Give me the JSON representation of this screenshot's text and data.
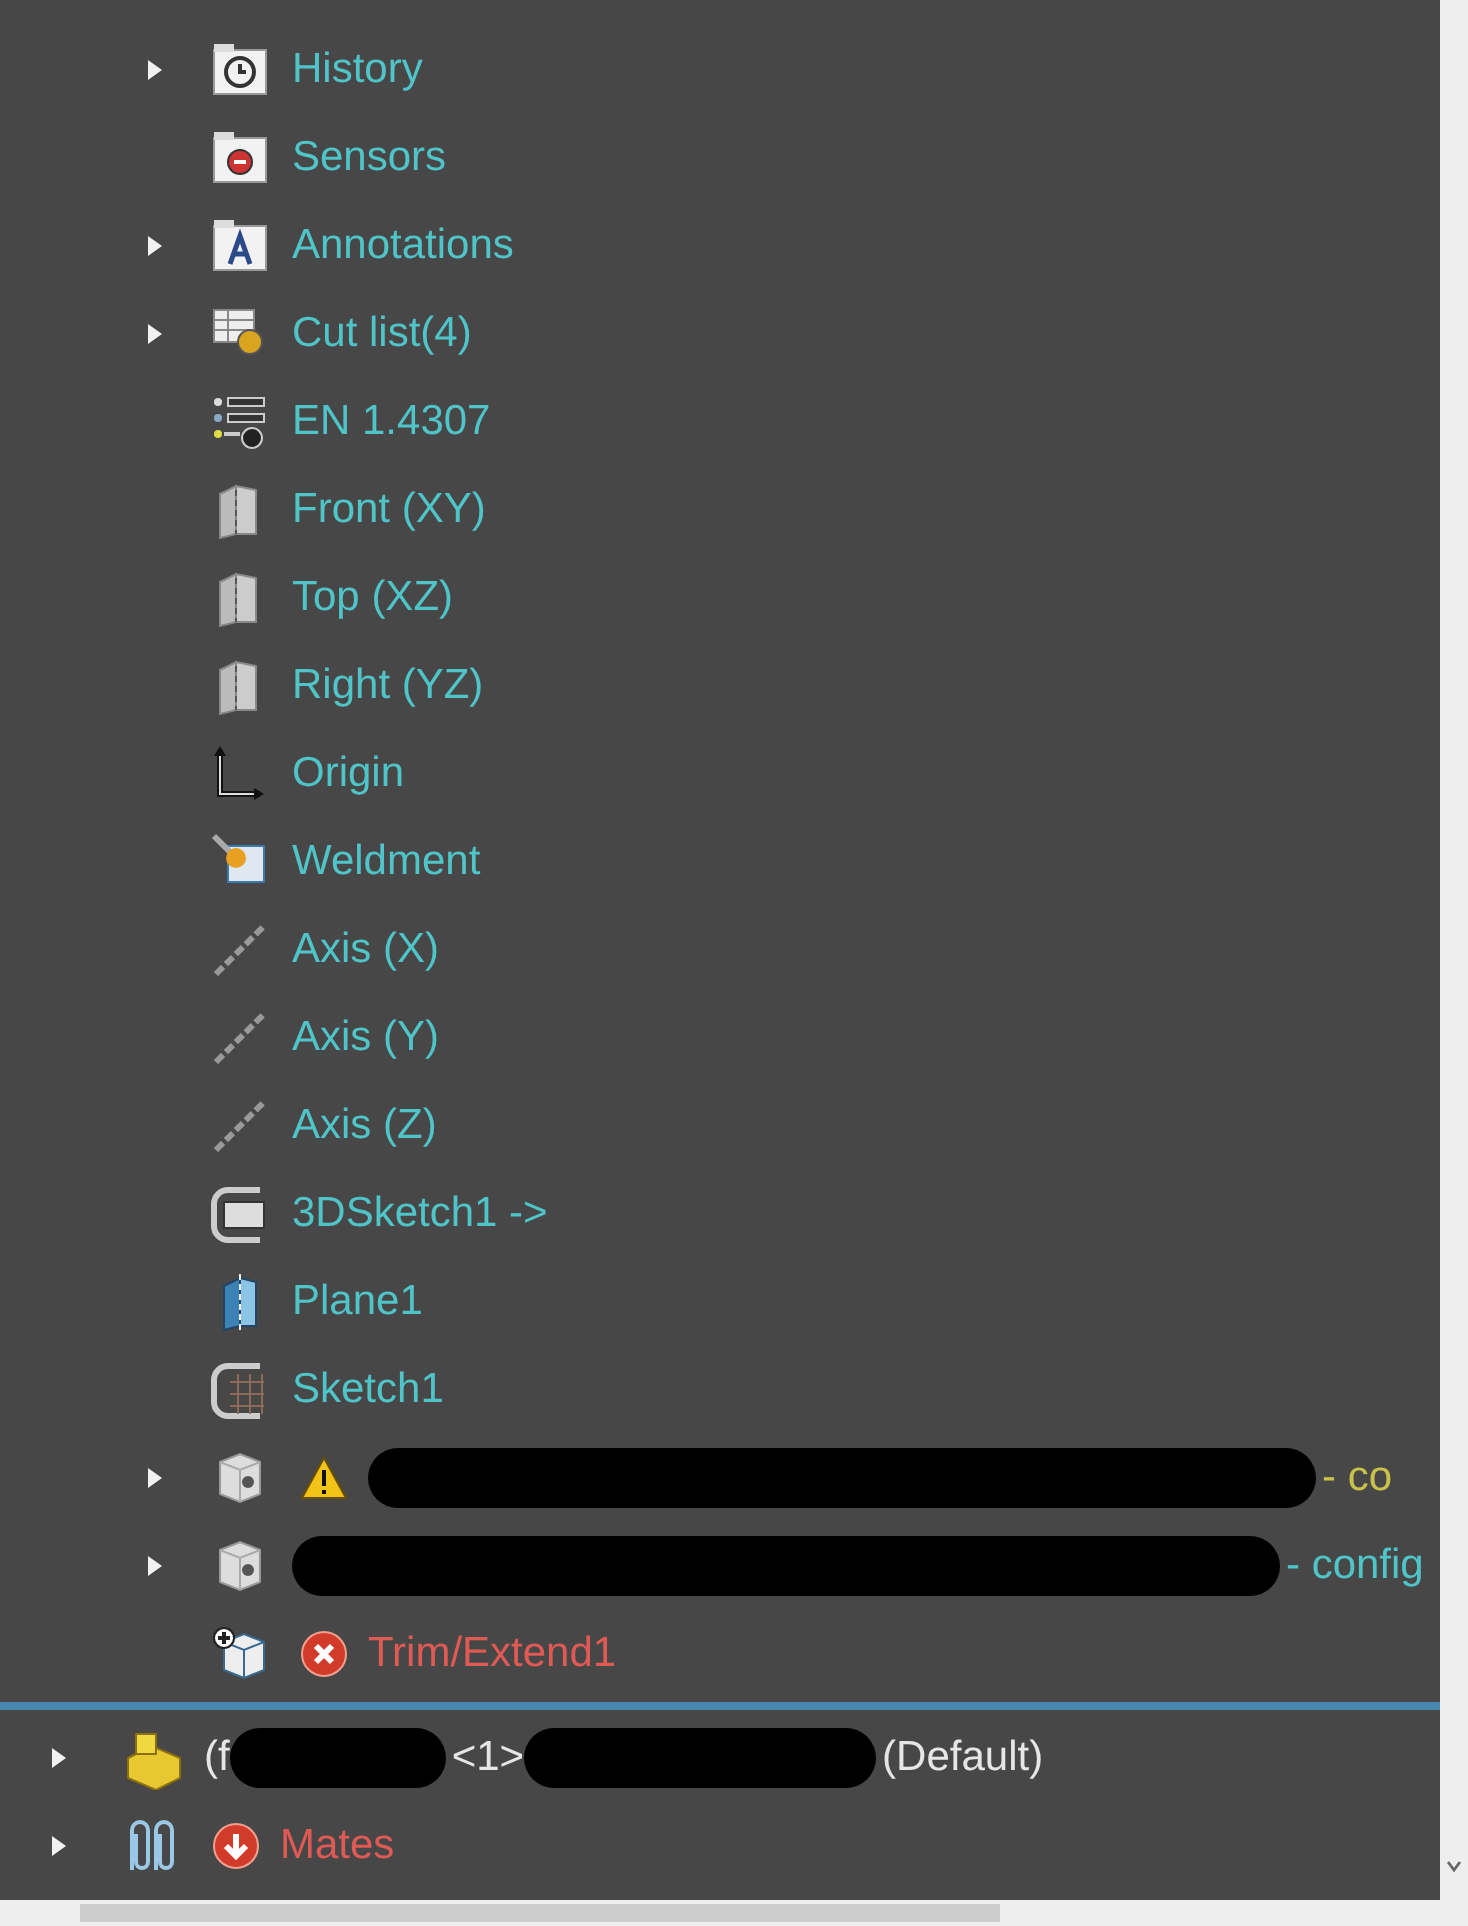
{
  "part_features": [
    {
      "kind": "history-folder",
      "has_children": true,
      "warning": false,
      "error": false,
      "label": [
        {
          "kind": "text",
          "text": "History",
          "color": "#4fc4c9"
        }
      ]
    },
    {
      "kind": "sensors-folder",
      "has_children": false,
      "warning": false,
      "error": false,
      "label": [
        {
          "kind": "text",
          "text": "Sensors",
          "color": "#4fc4c9"
        }
      ]
    },
    {
      "kind": "annotations-folder",
      "has_children": true,
      "warning": false,
      "error": false,
      "label": [
        {
          "kind": "text",
          "text": "Annotations",
          "color": "#4fc4c9"
        }
      ]
    },
    {
      "kind": "cut-list",
      "has_children": true,
      "warning": false,
      "error": false,
      "label": [
        {
          "kind": "text",
          "text": "Cut list(4)",
          "color": "#4fc4c9"
        }
      ]
    },
    {
      "kind": "material",
      "has_children": false,
      "warning": false,
      "error": false,
      "label": [
        {
          "kind": "text",
          "text": "EN 1.4307",
          "color": "#4fc4c9"
        }
      ]
    },
    {
      "kind": "plane",
      "has_children": false,
      "warning": false,
      "error": false,
      "label": [
        {
          "kind": "text",
          "text": "Front (XY)",
          "color": "#4fc4c9"
        }
      ]
    },
    {
      "kind": "plane",
      "has_children": false,
      "warning": false,
      "error": false,
      "label": [
        {
          "kind": "text",
          "text": "Top (XZ)",
          "color": "#4fc4c9"
        }
      ]
    },
    {
      "kind": "plane",
      "has_children": false,
      "warning": false,
      "error": false,
      "label": [
        {
          "kind": "text",
          "text": "Right (YZ)",
          "color": "#4fc4c9"
        }
      ]
    },
    {
      "kind": "origin",
      "has_children": false,
      "warning": false,
      "error": false,
      "label": [
        {
          "kind": "text",
          "text": "Origin",
          "color": "#4fc4c9"
        }
      ]
    },
    {
      "kind": "weldment",
      "has_children": false,
      "warning": false,
      "error": false,
      "label": [
        {
          "kind": "text",
          "text": "Weldment",
          "color": "#4fc4c9"
        }
      ]
    },
    {
      "kind": "axis",
      "has_children": false,
      "warning": false,
      "error": false,
      "label": [
        {
          "kind": "text",
          "text": "Axis (X)",
          "color": "#4fc4c9"
        }
      ]
    },
    {
      "kind": "axis",
      "has_children": false,
      "warning": false,
      "error": false,
      "label": [
        {
          "kind": "text",
          "text": "Axis (Y)",
          "color": "#4fc4c9"
        }
      ]
    },
    {
      "kind": "axis",
      "has_children": false,
      "warning": false,
      "error": false,
      "label": [
        {
          "kind": "text",
          "text": "Axis (Z)",
          "color": "#4fc4c9"
        }
      ]
    },
    {
      "kind": "sketch-3d",
      "has_children": false,
      "warning": false,
      "error": false,
      "label": [
        {
          "kind": "text",
          "text": "3DSketch1 ->",
          "color": "#4fc4c9"
        }
      ]
    },
    {
      "kind": "plane-blue",
      "has_children": false,
      "warning": false,
      "error": false,
      "label": [
        {
          "kind": "text",
          "text": "Plane1",
          "color": "#4fc4c9"
        }
      ]
    },
    {
      "kind": "sketch",
      "has_children": false,
      "warning": false,
      "error": false,
      "label": [
        {
          "kind": "text",
          "text": "Sketch1",
          "color": "#4fc4c9"
        }
      ]
    },
    {
      "kind": "part",
      "has_children": true,
      "warning": true,
      "error": false,
      "label": [
        {
          "kind": "redaction"
        },
        {
          "kind": "text",
          "text": "- co",
          "color": "#c9c24a"
        }
      ]
    },
    {
      "kind": "part",
      "has_children": true,
      "warning": false,
      "error": false,
      "label": [
        {
          "kind": "redaction"
        },
        {
          "kind": "text",
          "text": "- config",
          "color": "#4fc4c9"
        }
      ]
    },
    {
      "kind": "trim",
      "has_children": false,
      "warning": false,
      "error": true,
      "label": [
        {
          "kind": "text",
          "text": "Trim/Extend1",
          "color": "#e05a55"
        }
      ]
    }
  ],
  "assembly_items": [
    {
      "kind": "component",
      "has_children": true,
      "warning": false,
      "error": false,
      "label": [
        {
          "kind": "text",
          "text": "(f",
          "color": "#e6e6e6"
        },
        {
          "kind": "redaction"
        },
        {
          "kind": "text",
          "text": "<1>",
          "color": "#e6e6e6"
        },
        {
          "kind": "redaction"
        },
        {
          "kind": "text",
          "text": "(Default)",
          "color": "#e6e6e6"
        }
      ]
    },
    {
      "kind": "mates",
      "has_children": true,
      "warning": false,
      "error": true,
      "label": [
        {
          "kind": "text",
          "text": "Mates",
          "color": "#e05a55"
        }
      ]
    }
  ]
}
